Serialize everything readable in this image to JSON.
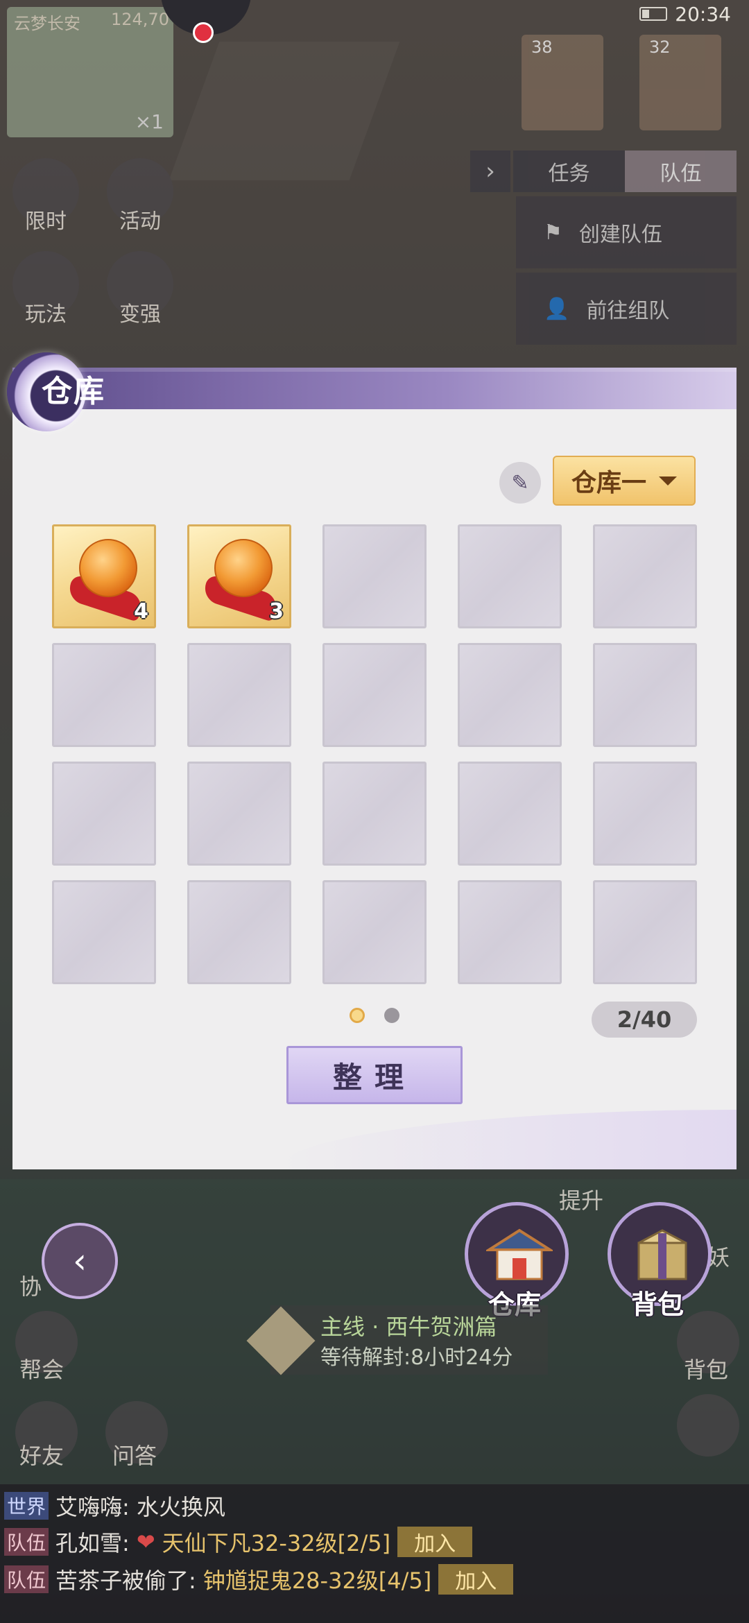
{
  "status": {
    "time": "20:34"
  },
  "minimap": {
    "title": "云梦长安",
    "coords": "124,70",
    "count": "×1"
  },
  "portraits": [
    {
      "level": "38"
    },
    {
      "level": "32"
    }
  ],
  "tabs": {
    "task": "任务",
    "team": "队伍"
  },
  "team_buttons": {
    "create": "创建队伍",
    "join": "前往组队"
  },
  "left_menu": [
    "限时",
    "活动",
    "玩法",
    "变强"
  ],
  "dialog": {
    "title": "仓库",
    "dropdown": "仓库一",
    "items": [
      {
        "count": "4"
      },
      {
        "count": "3"
      }
    ],
    "capacity": "2/40",
    "sort_label": "整理"
  },
  "actions": {
    "warehouse": "仓库",
    "backpack": "背包"
  },
  "side_labels": {
    "upgrade": "提升",
    "xie": "协",
    "yao": "妖",
    "guild": "帮会",
    "bag": "背包",
    "friends": "好友",
    "qa": "问答"
  },
  "quest": {
    "title": "主线 · 西牛贺洲篇",
    "subtitle": "等待解封:8小时24分"
  },
  "chat": [
    {
      "channel": "世界",
      "text": "艾嗨嗨: 水火换风"
    },
    {
      "channel": "队伍",
      "name": "孔如雪:",
      "text": "天仙下凡32-32级[2/5]",
      "button": "加入"
    },
    {
      "channel": "队伍",
      "name": "苦茶子被偷了:",
      "text": "钟馗捉鬼28-32级[4/5]",
      "button": "加入"
    }
  ],
  "colors": {
    "accent": "#9a88c2",
    "gold": "#f1c36b",
    "chat_gold": "#e7c36c"
  }
}
